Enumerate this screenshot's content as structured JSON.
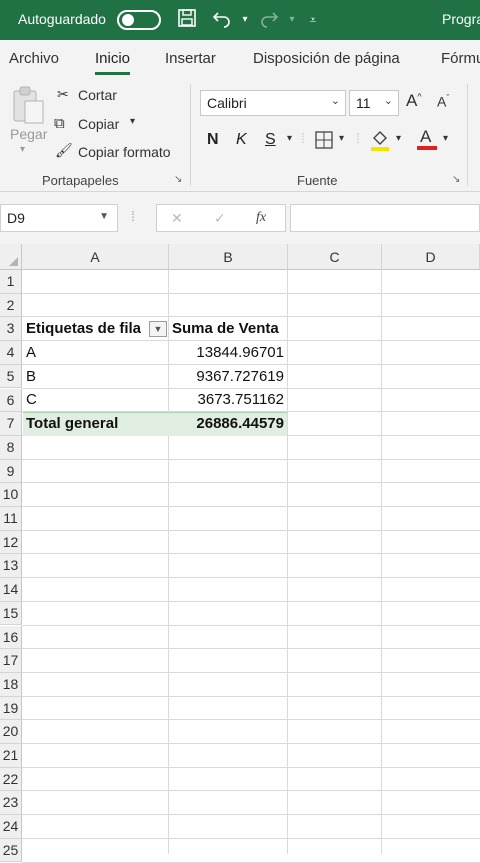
{
  "titlebar": {
    "autosave_label": "Autoguardado",
    "app_title": "Progra"
  },
  "tabs": [
    "Archivo",
    "Inicio",
    "Insertar",
    "Disposición de página",
    "Fórmu"
  ],
  "ribbon": {
    "paste_label": "Pegar",
    "cut_label": "Cortar",
    "copy_label": "Copiar",
    "format_painter_label": "Copiar formato",
    "clipboard_group": "Portapapeles",
    "font_name": "Calibri",
    "font_size": "11",
    "bold": "N",
    "italic": "K",
    "underline": "S",
    "font_group": "Fuente",
    "font_color": "#e02020",
    "fill_color": "#f2e600"
  },
  "formula_bar": {
    "name_box": "D9",
    "fx_label": "fx",
    "formula": ""
  },
  "grid": {
    "columns": [
      "A",
      "B",
      "C",
      "D"
    ],
    "rows": [
      "1",
      "2",
      "3",
      "4",
      "5",
      "6",
      "7",
      "8",
      "9",
      "10",
      "11",
      "12",
      "13",
      "14",
      "15",
      "16",
      "17",
      "18",
      "19",
      "20",
      "21",
      "22",
      "23",
      "24",
      "25"
    ],
    "pivot": {
      "header_row_label": "Etiquetas de fila",
      "header_value": "Suma de Venta",
      "items": [
        {
          "label": "A",
          "value": "13844.96701"
        },
        {
          "label": "B",
          "value": "9367.727619"
        },
        {
          "label": "C",
          "value": "3673.751162"
        }
      ],
      "total_label": "Total general",
      "total_value": "26886.44579"
    }
  },
  "colors": {
    "accent": "#217346",
    "titlebar": "#207245",
    "total_fill": "#dfeee0"
  }
}
